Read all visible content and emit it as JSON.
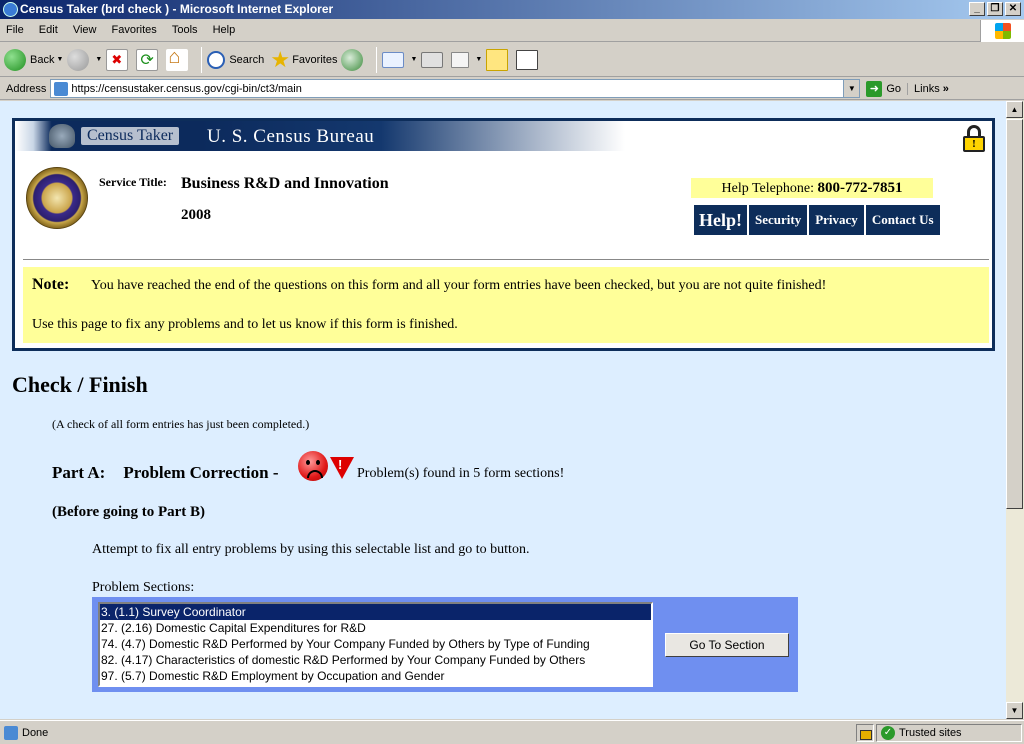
{
  "window": {
    "title": "Census Taker (brd check ) - Microsoft Internet Explorer",
    "buttons": [
      "_",
      "❐",
      "✕"
    ]
  },
  "menu": [
    "File",
    "Edit",
    "View",
    "Favorites",
    "Tools",
    "Help"
  ],
  "toolbar": {
    "back": "Back",
    "search": "Search",
    "favorites": "Favorites"
  },
  "address": {
    "label": "Address",
    "url": "https://censustaker.census.gov/cgi-bin/ct3/main",
    "go": "Go",
    "links": "Links"
  },
  "header": {
    "app_name": "Census Taker",
    "bureau": "U. S. Census Bureau",
    "service_label": "Service Title:",
    "service_title": "Business R&D and Innovation",
    "year": "2008",
    "help_tel_label": "Help Telephone:",
    "help_tel_number": "800-772-7851",
    "nav": [
      "Help!",
      "Security",
      "Privacy",
      "Contact Us"
    ],
    "lock_symbol": "!"
  },
  "note": {
    "label": "Note:",
    "line1": "You have reached the end of the questions on this form and all your form entries have been checked, but you are not quite finished!",
    "line2": "Use this page to fix any problems and to let us know if this form is finished."
  },
  "main": {
    "title": "Check / Finish",
    "check_note": "(A check of all form entries has just been completed.)",
    "part_label": "Part A:",
    "part_title": "Problem Correction",
    "part_dash": "-",
    "problems_found": "Problem(s) found in 5 form sections!",
    "warn_symbol": "!",
    "before_b": "(Before going to Part B)",
    "attempt": "Attempt to fix all entry problems by using this selectable list and go to button.",
    "problem_sections_label": "Problem Sections:",
    "problem_sections": [
      "3. (1.1) Survey Coordinator",
      "27. (2.16) Domestic Capital Expenditures for R&D",
      "74. (4.7) Domestic R&D Performed by Your Company Funded by Others by Type of Funding",
      "82. (4.17) Characteristics of domestic R&D Performed by Your Company Funded by Others",
      "97. (5.7) Domestic R&D Employment by Occupation and Gender"
    ],
    "selected_index": 0,
    "goto_button": "Go To Section"
  },
  "status": {
    "text": "Done",
    "zone": "Trusted sites"
  },
  "colors": {
    "navy": "#0d2d5a",
    "note_bg": "#ffff99",
    "content_bg": "#ddeeff",
    "list_panel": "#6f8ff0"
  }
}
